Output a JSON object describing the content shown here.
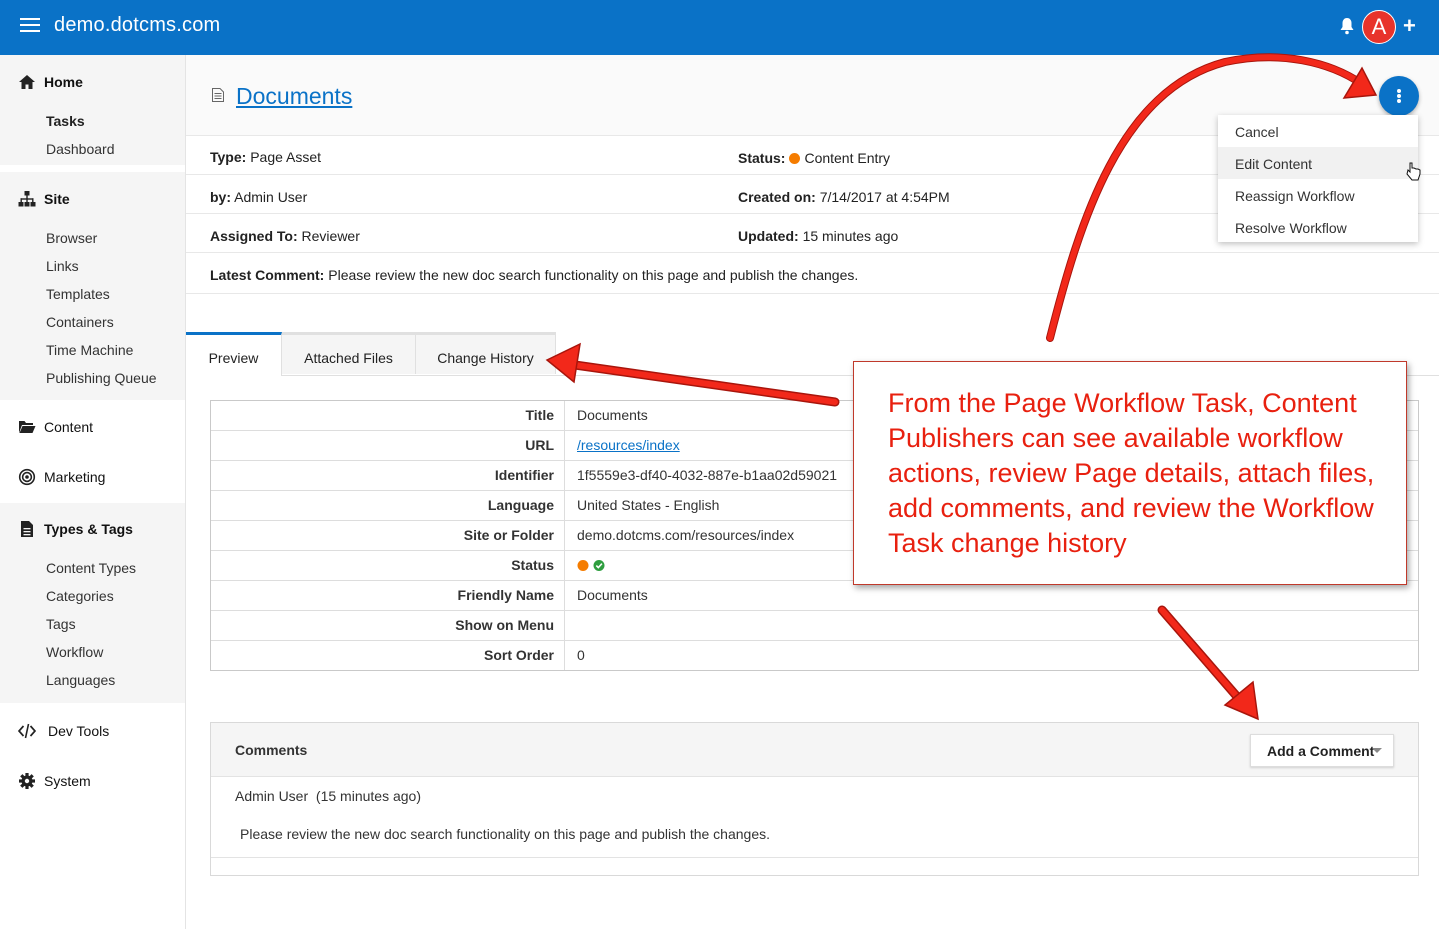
{
  "topbar": {
    "site": "demo.dotcms.com",
    "avatar_letter": "A",
    "accent": "#0a72c7"
  },
  "sidebar": {
    "home": {
      "label": "Home",
      "items": [
        "Tasks",
        "Dashboard"
      ]
    },
    "site": {
      "label": "Site",
      "items": [
        "Browser",
        "Links",
        "Templates",
        "Containers",
        "Time Machine",
        "Publishing Queue"
      ]
    },
    "content": {
      "label": "Content"
    },
    "marketing": {
      "label": "Marketing"
    },
    "types": {
      "label": "Types & Tags",
      "items": [
        "Content Types",
        "Categories",
        "Tags",
        "Workflow",
        "Languages"
      ]
    },
    "devtools": {
      "label": "Dev Tools"
    },
    "system": {
      "label": "System"
    }
  },
  "page": {
    "title": "Documents",
    "type_label": "Type:",
    "type_value": "Page Asset",
    "by_label": "by:",
    "by_value": "Admin User",
    "assigned_label": "Assigned To:",
    "assigned_value": "Reviewer",
    "comment_label": "Latest Comment:",
    "comment_value": "Please review the new doc search functionality on this page and publish the changes.",
    "status_label": "Status:",
    "status_value": "Content Entry",
    "created_label": "Created on:",
    "created_value": "7/14/2017 at 4:54PM",
    "updated_label": "Updated:",
    "updated_value": "15 minutes ago"
  },
  "tabs": [
    "Preview",
    "Attached Files",
    "Change History"
  ],
  "properties": [
    {
      "key": "Title",
      "value": "Documents"
    },
    {
      "key": "URL",
      "value": "/resources/index"
    },
    {
      "key": "Identifier",
      "value": "1f5559e3-df40-4032-887e-b1aa02d59021"
    },
    {
      "key": "Language",
      "value": "United States - English"
    },
    {
      "key": "Site or Folder",
      "value": "demo.dotcms.com/resources/index"
    },
    {
      "key": "Status",
      "value": ""
    },
    {
      "key": "Friendly Name",
      "value": "Documents"
    },
    {
      "key": "Show on Menu",
      "value": ""
    },
    {
      "key": "Sort Order",
      "value": "0"
    }
  ],
  "comments": {
    "title": "Comments",
    "add_label": "Add a Comment",
    "author": "Admin User",
    "when": "(15 minutes ago)",
    "text": "Please review the new doc search functionality on this page and publish the changes."
  },
  "actions_menu": [
    "Cancel",
    "Edit Content",
    "Reassign Workflow",
    "Resolve Workflow"
  ],
  "callout": {
    "text": "From the Page Workflow Task, Content Publishers can see available workflow actions, review Page details, attach files, add comments, and review the Workflow Task change history",
    "color": "#e8200f"
  }
}
